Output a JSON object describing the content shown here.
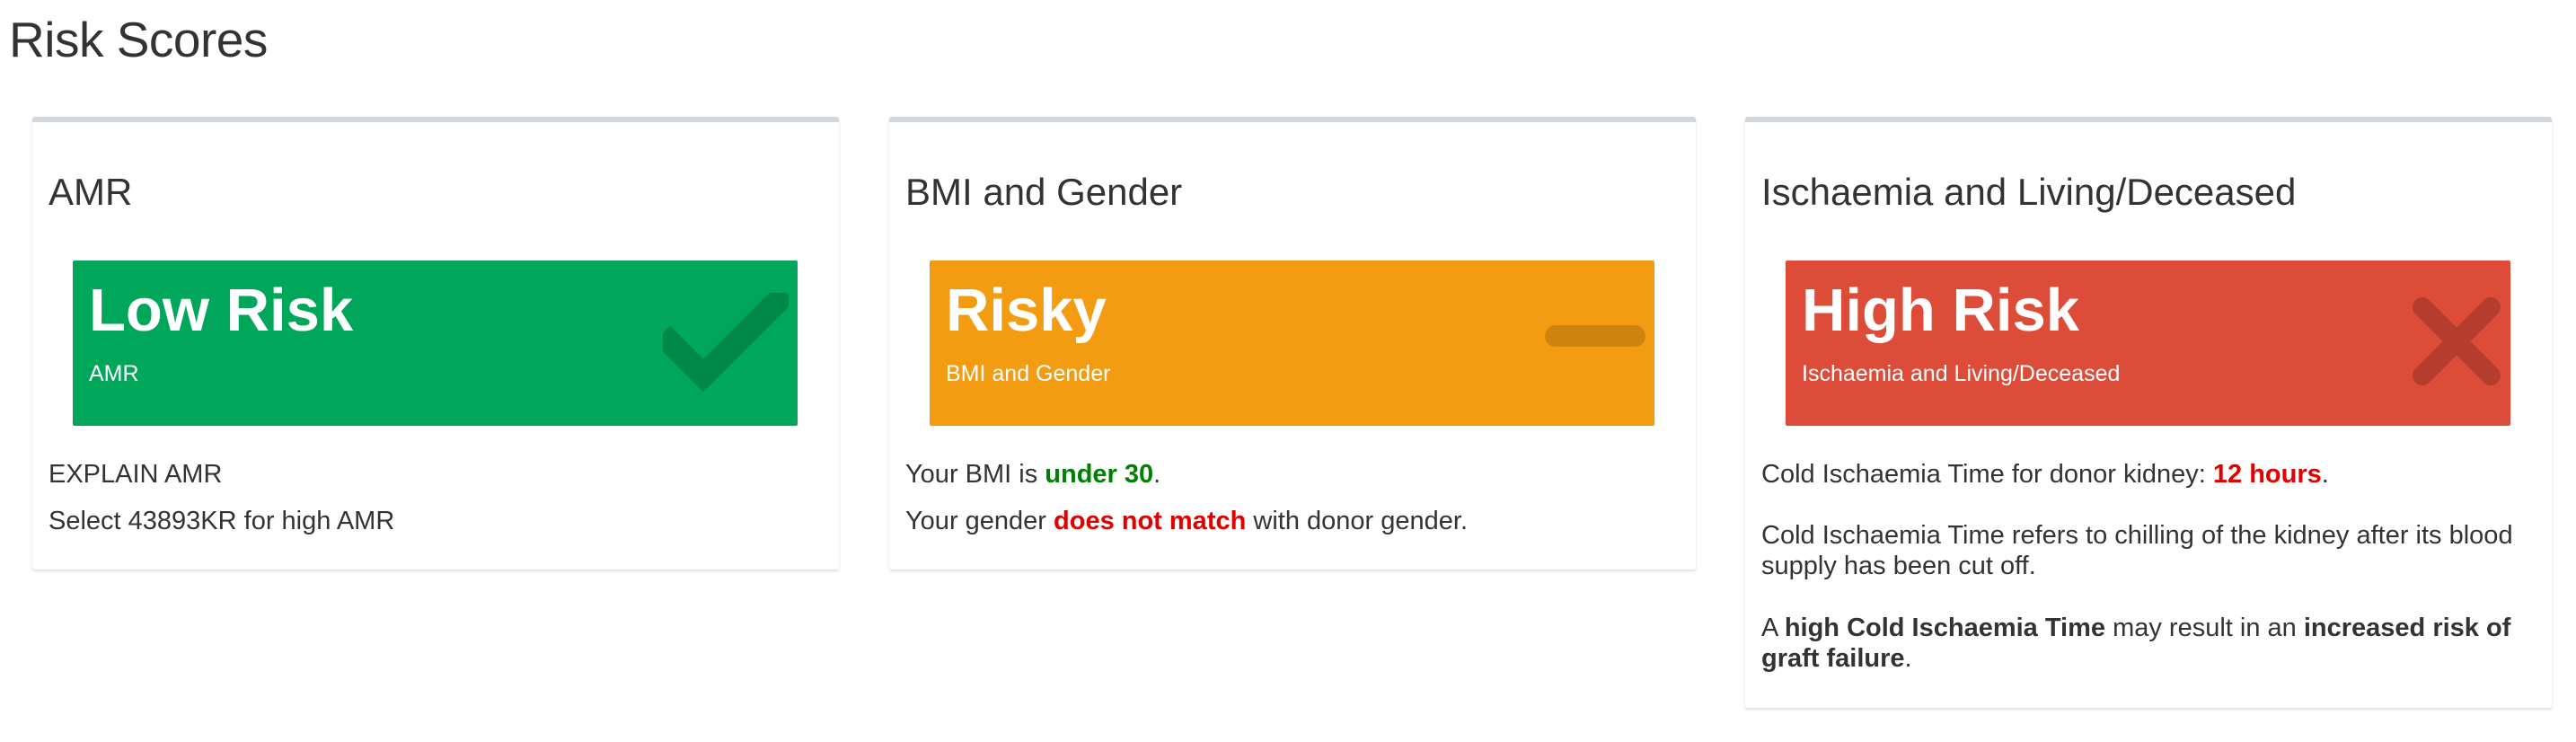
{
  "page": {
    "title": "Risk Scores"
  },
  "cards": {
    "amr": {
      "title": "AMR",
      "status": "Low Risk",
      "subtitle": "AMR",
      "icon": "check-icon",
      "color": "#00a65a",
      "lines": [
        "EXPLAIN AMR",
        "Select 43893KR for high AMR"
      ]
    },
    "bmi": {
      "title": "BMI and Gender",
      "status": "Risky",
      "subtitle": "BMI and Gender",
      "icon": "minus-icon",
      "color": "#f39c12",
      "bmi_prefix": "Your BMI is ",
      "bmi_value": "under 30",
      "bmi_suffix": ".",
      "gender_prefix": "Your gender ",
      "gender_value": "does not match",
      "gender_suffix": " with donor gender."
    },
    "ischaemia": {
      "title": "Ischaemia and Living/Deceased",
      "status": "High Risk",
      "subtitle": "Ischaemia and Living/Deceased",
      "icon": "times-icon",
      "color": "#dd4b39",
      "time_prefix": "Cold Ischaemia Time for donor kidney: ",
      "time_value": "12 hours",
      "time_suffix": ".",
      "definition": "Cold Ischaemia Time refers to chilling of the kidney after its blood supply has been cut off.",
      "warning_a": "A ",
      "warning_b": "high Cold Ischaemia Time",
      "warning_c": " may result in an ",
      "warning_d": "increased risk of graft failure",
      "warning_e": "."
    }
  }
}
